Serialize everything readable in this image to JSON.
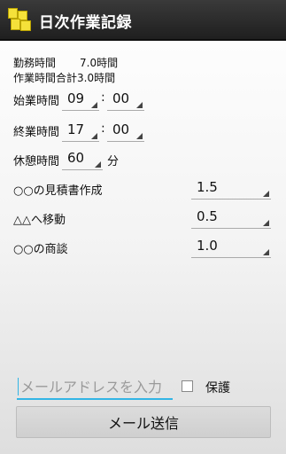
{
  "app": {
    "title": "日次作業記録",
    "icon": "sticky-notes-icon"
  },
  "summary": {
    "work_time_label": "勤務時間",
    "work_time_value": "7.0時間",
    "task_total": "作業時間合計3.0時間"
  },
  "start": {
    "label": "始業時間",
    "hour": "09",
    "minute": "00"
  },
  "end": {
    "label": "終業時間",
    "hour": "17",
    "minute": "00"
  },
  "break": {
    "label": "休憩時間",
    "value": "60",
    "unit": "分"
  },
  "separator": ":",
  "tasks": [
    {
      "name": "○○の見積書作成",
      "hours": "1.5"
    },
    {
      "name": "△△へ移動",
      "hours": "0.5"
    },
    {
      "name": "○○の商談",
      "hours": "1.0"
    }
  ],
  "email": {
    "placeholder": "メールアドレスを入力",
    "value": ""
  },
  "protect": {
    "label": "保護",
    "checked": false
  },
  "send_button": "メール送信",
  "colors": {
    "action_bar": "#2a2a2a",
    "accent": "#33b5e5",
    "icon": "#f5e13a"
  }
}
